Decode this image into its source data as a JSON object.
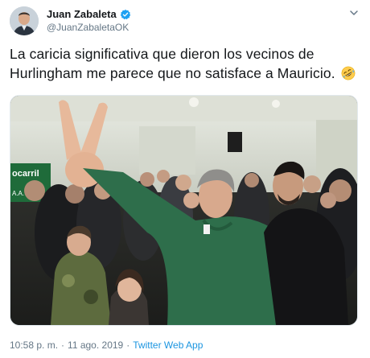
{
  "user": {
    "display_name": "Juan Zabaleta",
    "handle": "@JuanZabaletaOK",
    "verified": true
  },
  "tweet": {
    "text": "La caricia significativa que dieron los vecinos de Hurlingham me parece que no satisface a Mauricio.",
    "emoji": "rolling-on-the-floor-laughing-emoji",
    "photo_sign_text": "ocarril\nA.A.",
    "time": "10:58 p. m.",
    "separator": "·",
    "date": "11 ago. 2019",
    "source": "Twitter Web App"
  },
  "colors": {
    "verified": "#1da1f2",
    "link": "#1b95e0",
    "secondary_text": "#657786"
  }
}
